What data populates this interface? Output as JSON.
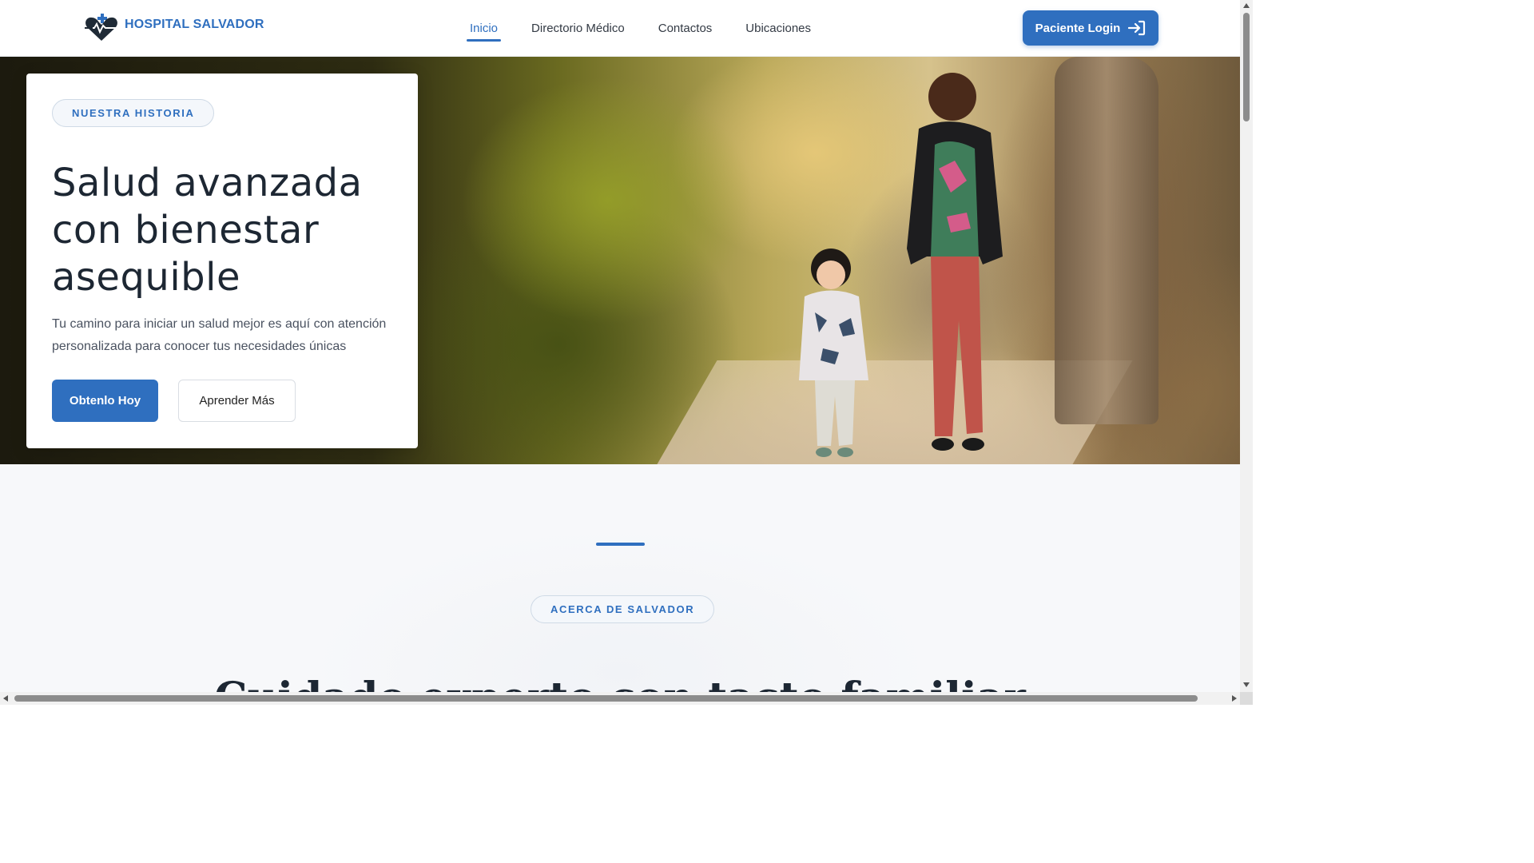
{
  "header": {
    "logo_text": "HOSPITAL SALVADOR",
    "nav": [
      {
        "label": "Inicio",
        "active": true
      },
      {
        "label": "Directorio Médico",
        "active": false
      },
      {
        "label": "Contactos",
        "active": false
      },
      {
        "label": "Ubicaciones",
        "active": false
      }
    ],
    "login_label": "Paciente Login"
  },
  "hero": {
    "badge": "NUESTRA HISTORIA",
    "title": "Salud avanzada con bienestar asequible",
    "text": "Tu camino para iniciar un salud mejor es aquí con atención personalizada para conocer tus necesidades únicas",
    "primary_button": "Obtenlo Hoy",
    "secondary_button": "Aprender Más"
  },
  "about": {
    "badge": "ACERCA DE SALVADOR",
    "heading": "Cuidado experto con tacto familiar"
  },
  "colors": {
    "accent": "#2f6fbf",
    "text_dark": "#1d2733"
  },
  "icons": {
    "logo": "hospital-heart-cross-icon",
    "login": "sign-in-arrow-icon"
  }
}
